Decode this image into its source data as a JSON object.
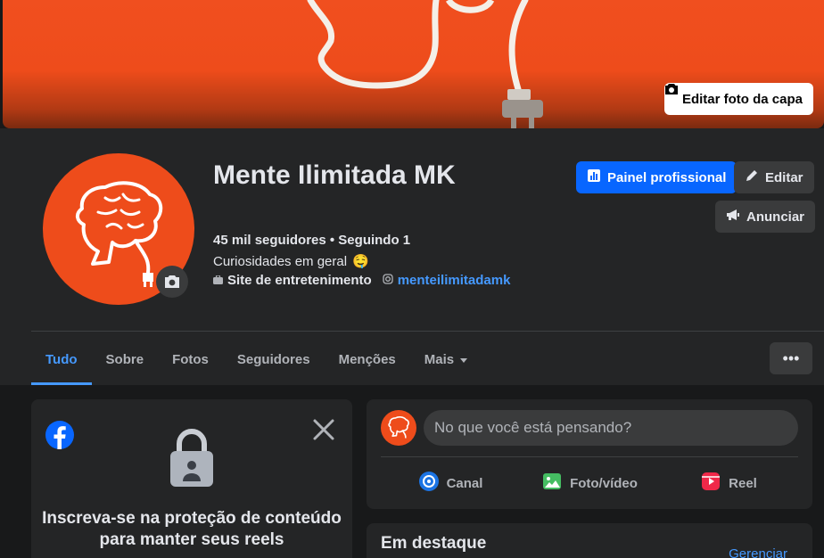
{
  "cover": {
    "edit_label": "Editar foto da capa",
    "camera_icon": "camera-icon",
    "color": "#ee4c1b"
  },
  "profile": {
    "name": "Mente Ilimitada MK",
    "followers": "45 mil seguidores • Seguindo 1",
    "category": "Curiosidades em geral",
    "category_emoji": "🤤",
    "page_type": "Site de entretenimento",
    "instagram": "menteilimitadamk"
  },
  "buttons": {
    "dashboard": "Painel profissional",
    "edit": "Editar",
    "advertise": "Anunciar",
    "more": "•••"
  },
  "tabs": [
    {
      "label": "Tudo",
      "active": true
    },
    {
      "label": "Sobre"
    },
    {
      "label": "Fotos"
    },
    {
      "label": "Seguidores"
    },
    {
      "label": "Menções"
    },
    {
      "label": "Mais"
    }
  ],
  "promo": {
    "title": "Inscreva-se na proteção de conteúdo para manter seus reels"
  },
  "composer": {
    "placeholder": "No que você está pensando?",
    "actions": [
      "Canal",
      "Foto/vídeo",
      "Reel"
    ]
  },
  "highlights": {
    "title": "Em destaque",
    "manage": "Gerenciar"
  },
  "colors": {
    "accent": "#0866ff",
    "link": "#4599ff",
    "brand_orange": "#ee4c1b",
    "background": "#18191a",
    "card": "#242526"
  }
}
